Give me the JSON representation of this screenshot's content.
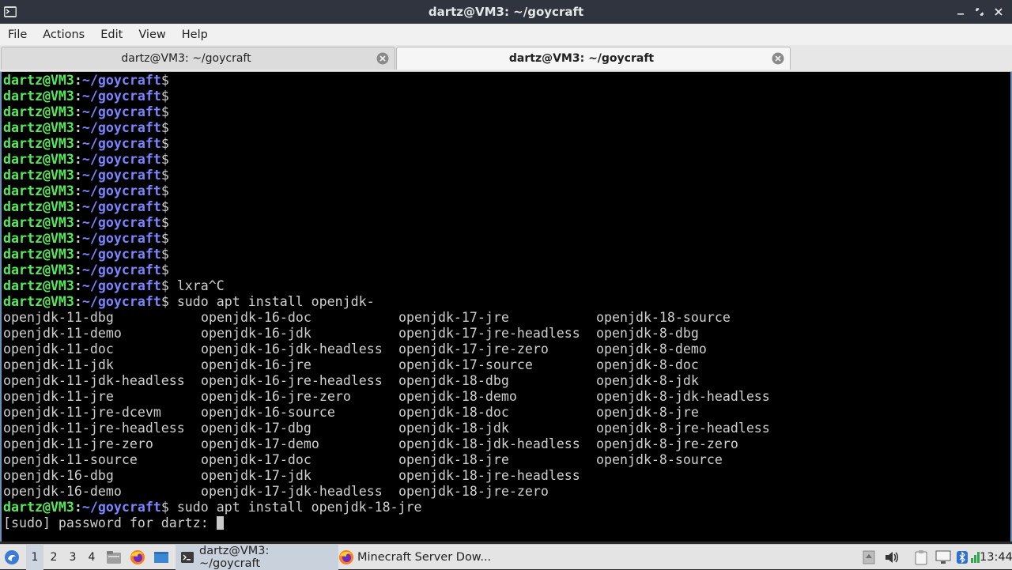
{
  "window": {
    "title": "dartz@VM3: ~/goycraft",
    "app_icon": "terminal-icon",
    "controls": [
      "minimize-icon",
      "maximize-icon",
      "close-icon"
    ]
  },
  "menu": [
    "File",
    "Actions",
    "Edit",
    "View",
    "Help"
  ],
  "tabs": [
    {
      "label": "dartz@VM3: ~/goycraft",
      "active": false
    },
    {
      "label": "dartz@VM3: ~/goycraft",
      "active": true
    }
  ],
  "prompt": {
    "user_host": "dartz@VM3",
    "sep": ":",
    "path": "~/goycraft",
    "dollar": "$",
    "user_color": "#58e95a",
    "path_color": "#7b85ff"
  },
  "terminal": {
    "empty_prompts": 13,
    "cmd1": " lxra^C",
    "cmd2": " sudo apt install openjdk-",
    "completions": [
      "openjdk-11-dbg",
      "openjdk-16-doc",
      "openjdk-17-jre",
      "openjdk-18-source",
      "openjdk-11-demo",
      "openjdk-16-jdk",
      "openjdk-17-jre-headless",
      "openjdk-8-dbg",
      "openjdk-11-doc",
      "openjdk-16-jdk-headless",
      "openjdk-17-jre-zero",
      "openjdk-8-demo",
      "openjdk-11-jdk",
      "openjdk-16-jre",
      "openjdk-17-source",
      "openjdk-8-doc",
      "openjdk-11-jdk-headless",
      "openjdk-16-jre-headless",
      "openjdk-18-dbg",
      "openjdk-8-jdk",
      "openjdk-11-jre",
      "openjdk-16-jre-zero",
      "openjdk-18-demo",
      "openjdk-8-jdk-headless",
      "openjdk-11-jre-dcevm",
      "openjdk-16-source",
      "openjdk-18-doc",
      "openjdk-8-jre",
      "openjdk-11-jre-headless",
      "openjdk-17-dbg",
      "openjdk-18-jdk",
      "openjdk-8-jre-headless",
      "openjdk-11-jre-zero",
      "openjdk-17-demo",
      "openjdk-18-jdk-headless",
      "openjdk-8-jre-zero",
      "openjdk-11-source",
      "openjdk-17-doc",
      "openjdk-18-jre",
      "openjdk-8-source",
      "openjdk-16-dbg",
      "openjdk-17-jdk",
      "openjdk-18-jre-headless",
      "",
      "openjdk-16-demo",
      "openjdk-17-jdk-headless",
      "openjdk-18-jre-zero",
      ""
    ],
    "cmd3": " sudo apt install openjdk-18-jre",
    "sudo_prompt": "[sudo] password for dartz: "
  },
  "taskbar": {
    "start_icon": "lxqt-start-icon",
    "workspaces": [
      "1",
      "2",
      "3",
      "4"
    ],
    "active_workspace": "1",
    "quicklaunch": [
      "file-manager-icon",
      "firefox-icon",
      "desktop-icon"
    ],
    "tasks": [
      {
        "label": "dartz@VM3: ~/goycraft",
        "icon": "terminal-icon",
        "active": true
      },
      {
        "label": "Minecraft Server Dow...",
        "icon": "firefox-icon",
        "active": false
      }
    ],
    "tray": [
      "notification-icon",
      "volume-icon",
      "clipboard-icon",
      "display-icon",
      "bluetooth-icon",
      "network-icon"
    ],
    "clock": "13:44"
  }
}
